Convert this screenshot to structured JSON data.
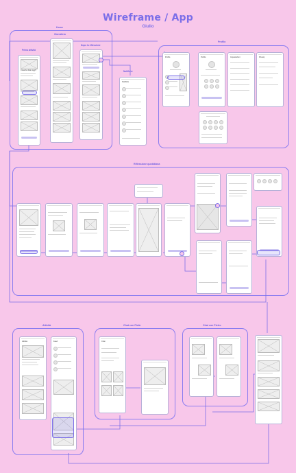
{
  "header": {
    "title": "Wireframe / App",
    "subtitle": "Giulio"
  },
  "regions": [
    {
      "id": "home",
      "label": "Home"
    },
    {
      "id": "profilo",
      "label": "Profilo"
    },
    {
      "id": "riflessione",
      "label": "Riflessione quotidiana"
    },
    {
      "id": "attivita",
      "label": "Attività"
    },
    {
      "id": "chat-pari",
      "label": "Chat con Pietà"
    },
    {
      "id": "chat-pietro",
      "label": "Chat con Pietro"
    }
  ],
  "screen_labels": {
    "prima": "Prima attività",
    "giornaliera": "Giornaliera",
    "dopo": "Dopo la riflessione",
    "notifiche": "Notifiche"
  },
  "phone_texts": {
    "home1_q": "Cosa hai fatto oggi?",
    "notifiche_title": "Notifiche",
    "profilo1_title": "Profilo",
    "profilo2_title": "Profilo",
    "impostazioni_title": "Impostazioni",
    "privacy_title": "Privacy",
    "attivita_title": "Attività",
    "feed_title": "Feed",
    "chat_title": "Chat"
  },
  "accent": "#7b6ee8",
  "background": "#f8c7ea"
}
